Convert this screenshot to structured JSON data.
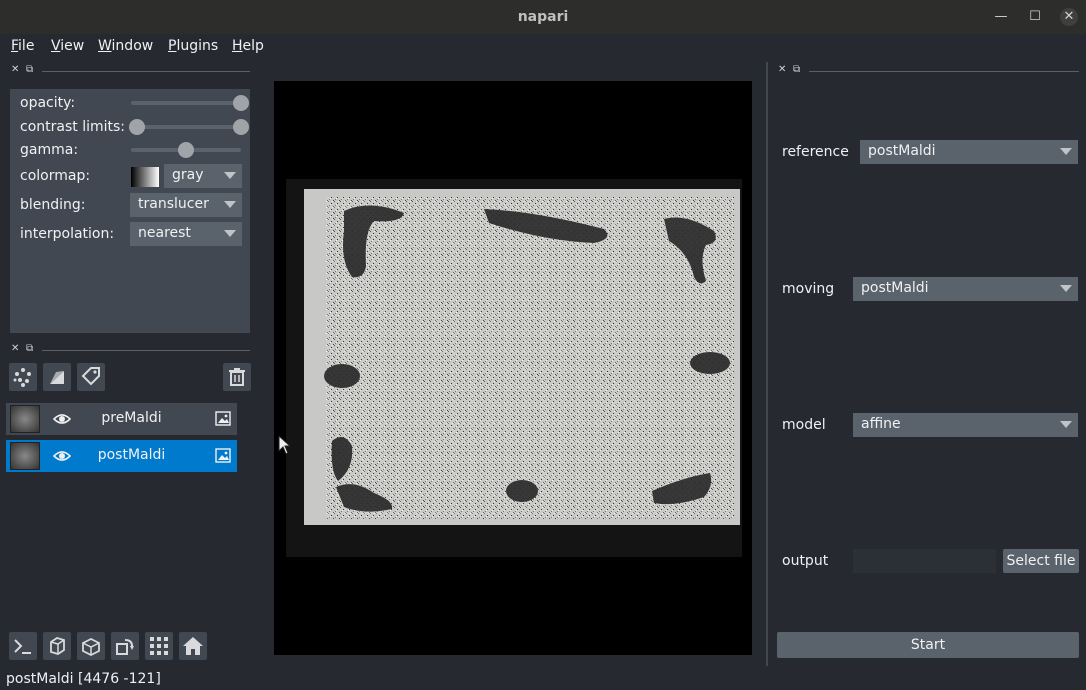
{
  "window": {
    "title": "napari",
    "minimize_glyph": "—",
    "maximize_glyph": "☐",
    "close_glyph": "✕"
  },
  "menu": [
    {
      "label": "File",
      "accel": "F",
      "rest": "ile"
    },
    {
      "label": "View",
      "accel": "V",
      "rest": "iew"
    },
    {
      "label": "Window",
      "accel": "W",
      "rest": "indow"
    },
    {
      "label": "Plugins",
      "accel": "P",
      "rest": "lugins"
    },
    {
      "label": "Help",
      "accel": "H",
      "rest": "elp"
    }
  ],
  "dock_controls": {
    "close_glyph": "✕",
    "float_glyph": "⧉"
  },
  "layer_controls": {
    "opacity_label": "opacity:",
    "opacity_value": 1.0,
    "contrast_label": "contrast limits:",
    "contrast_range": [
      0.0,
      1.0
    ],
    "gamma_label": "gamma:",
    "gamma_value": 0.5,
    "colormap_label": "colormap:",
    "colormap_value": "gray",
    "blending_label": "blending:",
    "blending_value": "translucer",
    "interpolation_label": "interpolation:",
    "interpolation_value": "nearest"
  },
  "layer_tools": [
    "points-icon",
    "shapes-icon",
    "labels-icon",
    "delete-icon"
  ],
  "layers": [
    {
      "name": "preMaldi",
      "selected": false,
      "visible": true
    },
    {
      "name": "postMaldi",
      "selected": true,
      "visible": true
    }
  ],
  "viewer_buttons": [
    "console-icon",
    "ndisplay-icon",
    "roll-icon",
    "transpose-icon",
    "grid-icon",
    "home-icon"
  ],
  "status": {
    "text": "postMaldi [4476 -121]"
  },
  "plugin_panel": {
    "reference_label": "reference",
    "reference_value": "postMaldi",
    "moving_label": "moving",
    "moving_value": "postMaldi",
    "model_label": "model",
    "model_value": "affine",
    "output_label": "output",
    "output_value": "",
    "select_file_label": "Select file",
    "start_label": "Start"
  },
  "colors": {
    "accent": "#007acc",
    "panel": "#414851",
    "background": "#262930"
  }
}
